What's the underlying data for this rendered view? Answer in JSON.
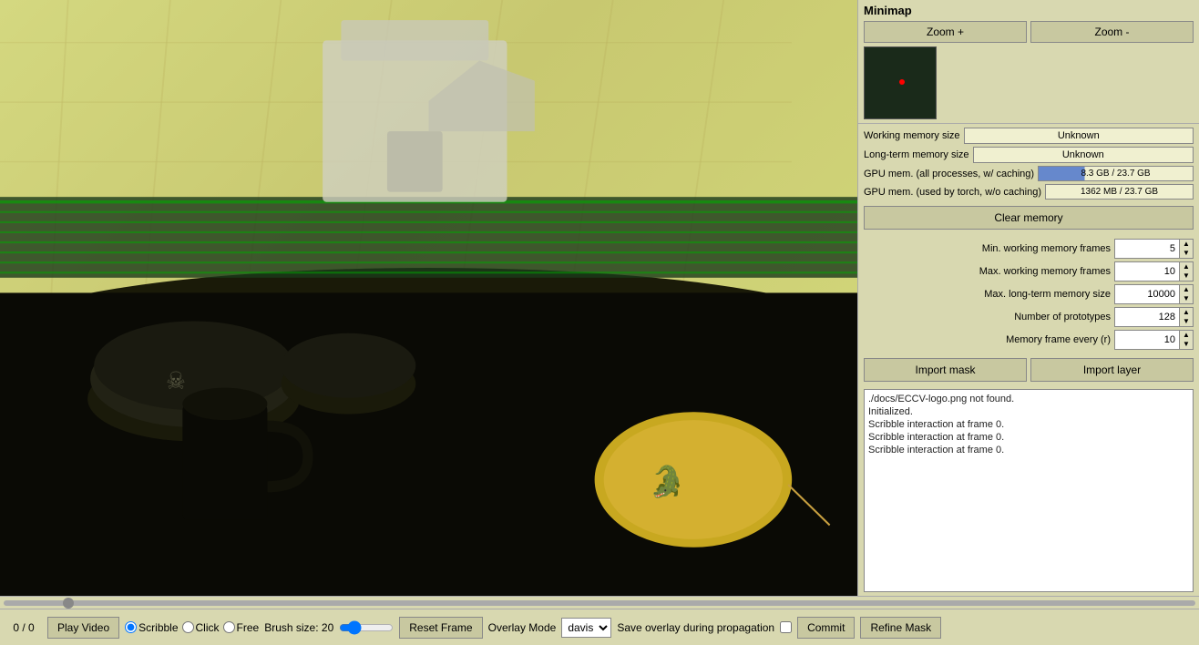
{
  "minimap": {
    "title": "Minimap",
    "zoom_plus": "Zoom +",
    "zoom_minus": "Zoom -"
  },
  "memory": {
    "working_label": "Working memory size",
    "working_value": "Unknown",
    "longterm_label": "Long-term memory size",
    "longterm_value": "Unknown",
    "gpu_all_label": "GPU mem. (all processes, w/ caching)",
    "gpu_all_value": "8.3 GB / 23.7 GB",
    "gpu_torch_label": "GPU mem. (used by torch, w/o caching)",
    "gpu_torch_value": "1362 MB / 23.7 GB",
    "clear_btn": "Clear memory"
  },
  "params": {
    "min_working_label": "Min. working memory frames",
    "min_working_value": "5",
    "max_working_label": "Max. working memory frames",
    "max_working_value": "10",
    "max_longterm_label": "Max. long-term memory size",
    "max_longterm_value": "10000",
    "num_proto_label": "Number of prototypes",
    "num_proto_value": "128",
    "mem_frame_label": "Memory frame every (r)",
    "mem_frame_value": "10"
  },
  "import": {
    "mask_btn": "Import mask",
    "layer_btn": "Import layer"
  },
  "log": {
    "lines": [
      "./docs/ECCV-logo.png not found.",
      "Initialized.",
      "Scribble interaction at frame 0.",
      "Scribble interaction at frame 0.",
      "Scribble interaction at frame 0."
    ]
  },
  "bottom": {
    "frame_counter": "0 / 0",
    "play_btn": "Play Video",
    "mode_scribble": "Scribble",
    "mode_click": "Click",
    "mode_free": "Free",
    "brush_label": "Brush size: 20",
    "reset_btn": "Reset Frame",
    "overlay_label": "Overlay Mode",
    "overlay_option": "davis",
    "save_label": "Save overlay during propagation",
    "commit_btn": "Commit",
    "refine_btn": "Refine Mask"
  }
}
